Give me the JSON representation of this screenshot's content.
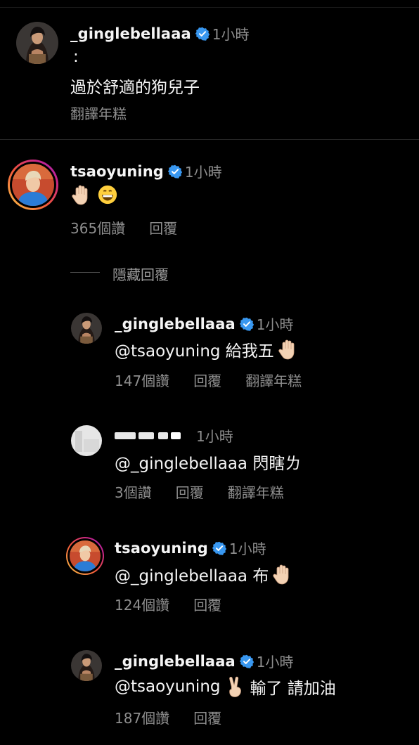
{
  "comments": [
    {
      "username": "_ginglebellaaa",
      "time": "1小時",
      "text_line1": ":",
      "text_line2": "過於舒適的狗兒子",
      "translate": "翻譯年糕"
    },
    {
      "username": "tsaoyuning",
      "time": "1小時",
      "text_emojis": [
        "raised-hand",
        "grinning-face"
      ],
      "likes": "365個讚",
      "reply": "回覆",
      "hide_replies": "隱藏回覆"
    }
  ],
  "replies": [
    {
      "username": "_ginglebellaaa",
      "time": "1小時",
      "text": "@tsaoyuning 給我五",
      "emoji": "raised-hand",
      "likes": "147個讚",
      "reply": "回覆",
      "translate": "翻譯年糕"
    },
    {
      "username_redacted": true,
      "time": "1小時",
      "text": "@_ginglebellaaa 閃瞎ㄌ",
      "likes": "3個讚",
      "reply": "回覆",
      "translate": "翻譯年糕"
    },
    {
      "username": "tsaoyuning",
      "time": "1小時",
      "text": "@_ginglebellaaa 布",
      "emoji": "raised-hand",
      "likes": "124個讚",
      "reply": "回覆"
    },
    {
      "username": "_ginglebellaaa",
      "time": "1小時",
      "text_before": "@tsaoyuning",
      "emoji": "victory-hand",
      "text_after": "輸了 請加油",
      "likes": "187個讚",
      "reply": "回覆"
    }
  ],
  "colors": {
    "background": "#000000",
    "verified": "#3897f0",
    "muted": "#8e8e8e"
  }
}
